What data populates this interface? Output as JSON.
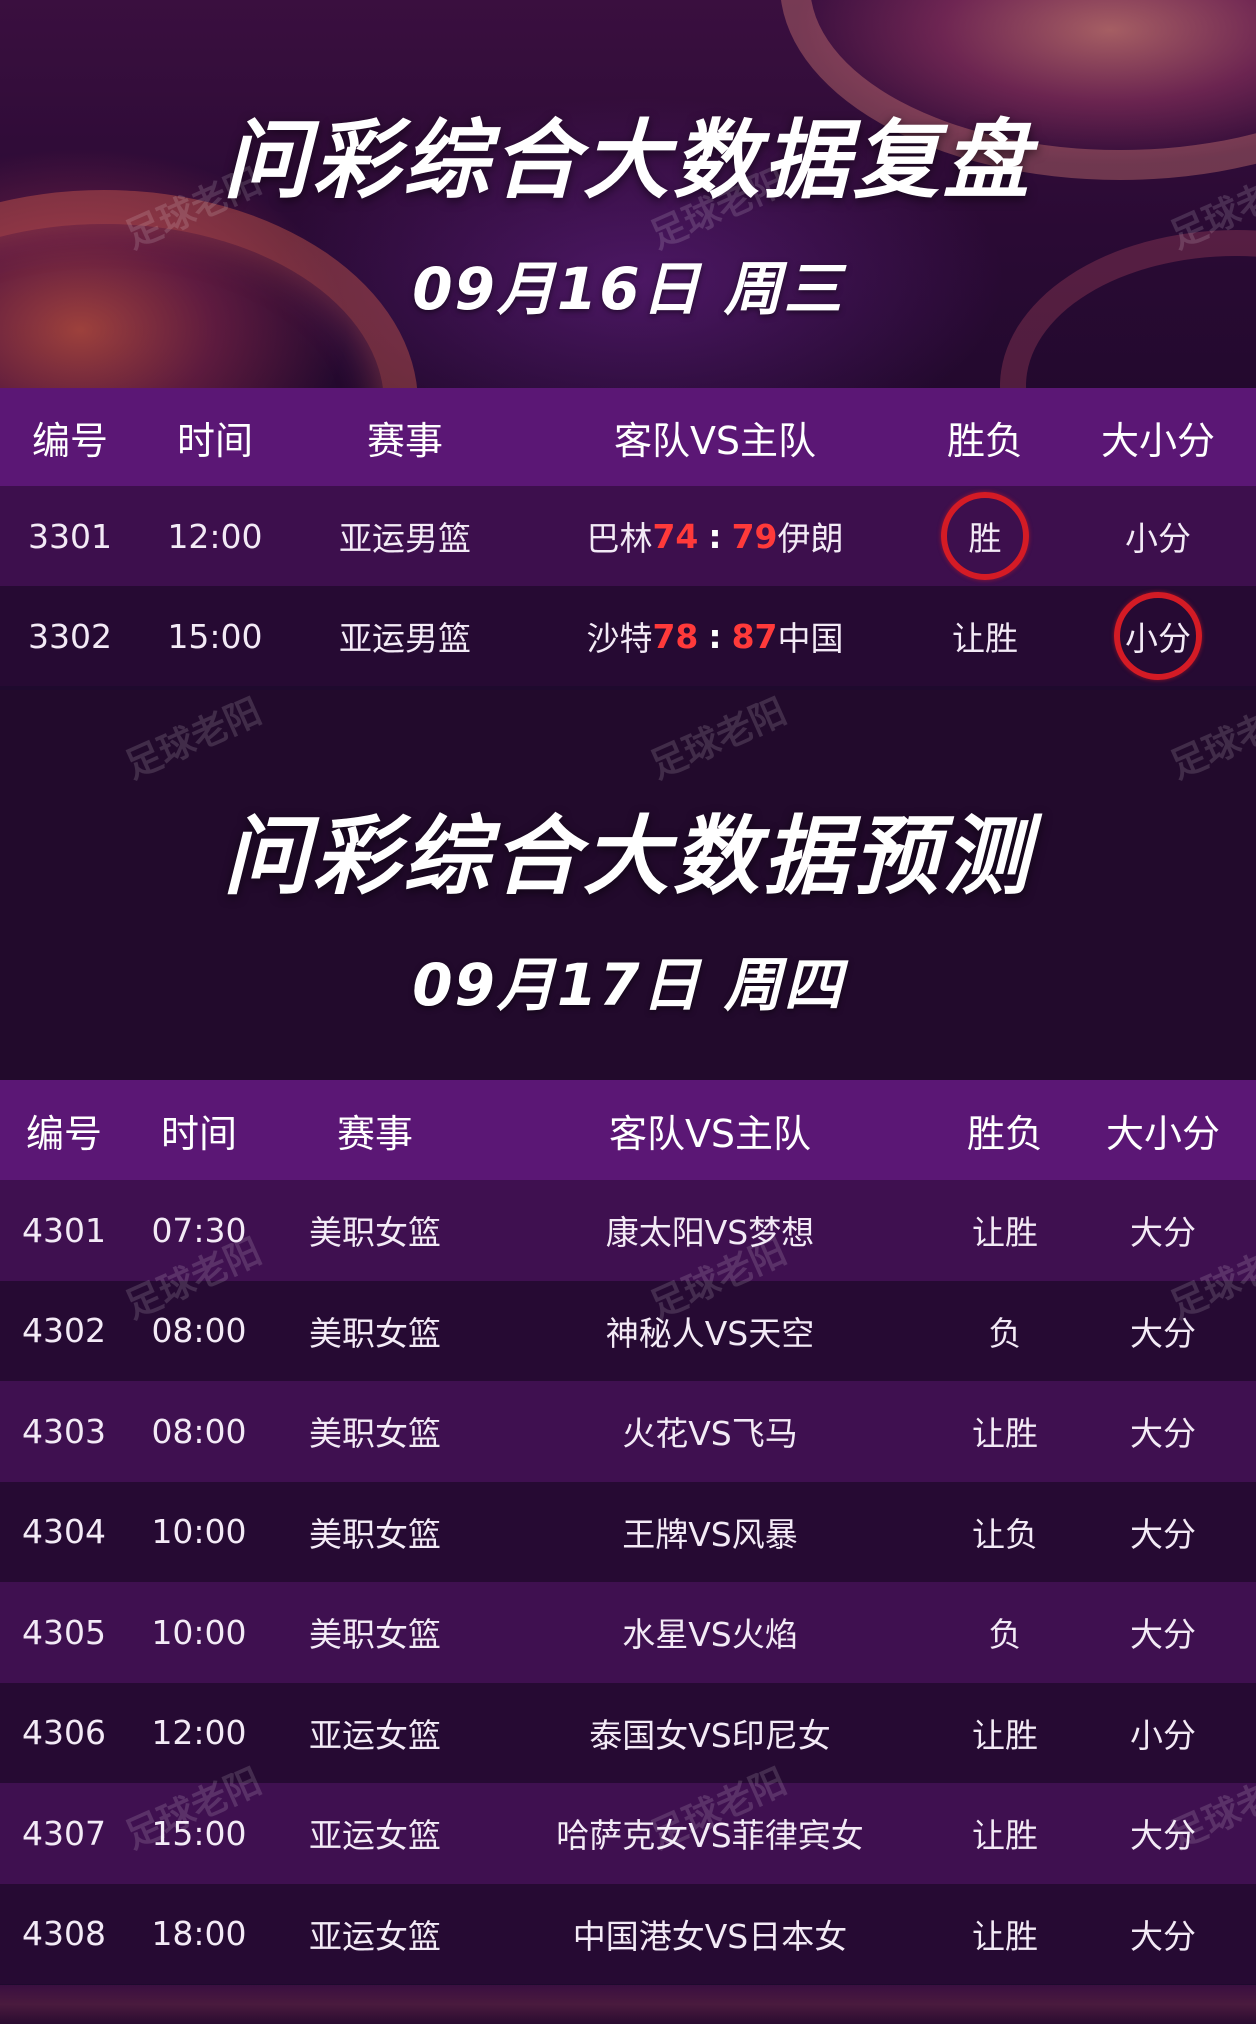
{
  "review": {
    "title": "问彩综合大数据复盘",
    "date": "09月16日 周三",
    "headers": [
      "编号",
      "时间",
      "赛事",
      "客队VS主队",
      "胜负",
      "大小分"
    ],
    "rows": [
      {
        "id": "3301",
        "time": "12:00",
        "league": "亚运男篮",
        "away": "巴林",
        "away_score": "74",
        "sep": ":",
        "home_score": "79",
        "home": "伊朗",
        "result": "胜",
        "total": "小分",
        "hit": "result"
      },
      {
        "id": "3302",
        "time": "15:00",
        "league": "亚运男篮",
        "away": "沙特",
        "away_score": "78",
        "sep": ":",
        "home_score": "87",
        "home": "中国",
        "result": "让胜",
        "total": "小分",
        "hit": "total"
      }
    ]
  },
  "forecast": {
    "title": "问彩综合大数据预测",
    "date": "09月17日 周四",
    "headers": [
      "编号",
      "时间",
      "赛事",
      "客队VS主队",
      "胜负",
      "大小分"
    ],
    "rows": [
      {
        "id": "4301",
        "time": "07:30",
        "league": "美职女篮",
        "match": "康太阳VS梦想",
        "result": "让胜",
        "total": "大分"
      },
      {
        "id": "4302",
        "time": "08:00",
        "league": "美职女篮",
        "match": "神秘人VS天空",
        "result": "负",
        "total": "大分"
      },
      {
        "id": "4303",
        "time": "08:00",
        "league": "美职女篮",
        "match": "火花VS飞马",
        "result": "让胜",
        "total": "大分"
      },
      {
        "id": "4304",
        "time": "10:00",
        "league": "美职女篮",
        "match": "王牌VS风暴",
        "result": "让负",
        "total": "大分"
      },
      {
        "id": "4305",
        "time": "10:00",
        "league": "美职女篮",
        "match": "水星VS火焰",
        "result": "负",
        "total": "大分"
      },
      {
        "id": "4306",
        "time": "12:00",
        "league": "亚运女篮",
        "match": "泰国女VS印尼女",
        "result": "让胜",
        "total": "小分"
      },
      {
        "id": "4307",
        "time": "15:00",
        "league": "亚运女篮",
        "match": "哈萨克女VS菲律宾女",
        "result": "让胜",
        "total": "大分"
      },
      {
        "id": "4308",
        "time": "18:00",
        "league": "亚运女篮",
        "match": "中国港女VS日本女",
        "result": "让胜",
        "total": "大分"
      }
    ]
  },
  "watermark": "足球老阳",
  "colors": {
    "header_bg": "#5b1775",
    "highlight_circle": "#d41b25",
    "score": "#ff3a3a"
  }
}
